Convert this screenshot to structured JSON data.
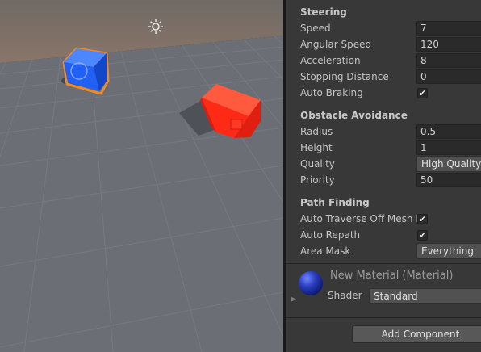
{
  "scene": {
    "colors": {
      "sky": "#7b6f66",
      "ground": "#6c6f76",
      "selection_outline": "#f08a24",
      "blue_cube": "#2a6cff",
      "red_cube": "#ff2a1a"
    },
    "icons": [
      "directional-light-icon"
    ]
  },
  "inspector": {
    "steering": {
      "title": "Steering",
      "speed": {
        "label": "Speed",
        "value": "7"
      },
      "angular_speed": {
        "label": "Angular Speed",
        "value": "120"
      },
      "acceleration": {
        "label": "Acceleration",
        "value": "8"
      },
      "stopping_distance": {
        "label": "Stopping Distance",
        "value": "0"
      },
      "auto_braking": {
        "label": "Auto Braking",
        "checked": true
      }
    },
    "obstacle_avoidance": {
      "title": "Obstacle Avoidance",
      "radius": {
        "label": "Radius",
        "value": "0.5"
      },
      "height": {
        "label": "Height",
        "value": "1"
      },
      "quality": {
        "label": "Quality",
        "value": "High Quality"
      },
      "priority": {
        "label": "Priority",
        "value": "50"
      }
    },
    "path_finding": {
      "title": "Path Finding",
      "auto_traverse": {
        "label": "Auto Traverse Off Mesh L",
        "checked": true
      },
      "auto_repath": {
        "label": "Auto Repath",
        "checked": true
      },
      "area_mask": {
        "label": "Area Mask",
        "value": "Everything"
      }
    },
    "material": {
      "title": "New Material (Material)",
      "shader_label": "Shader",
      "shader_value": "Standard",
      "ball_color": "#2b3fc0"
    },
    "add_component_label": "Add Component",
    "check_glyph": "✔"
  }
}
